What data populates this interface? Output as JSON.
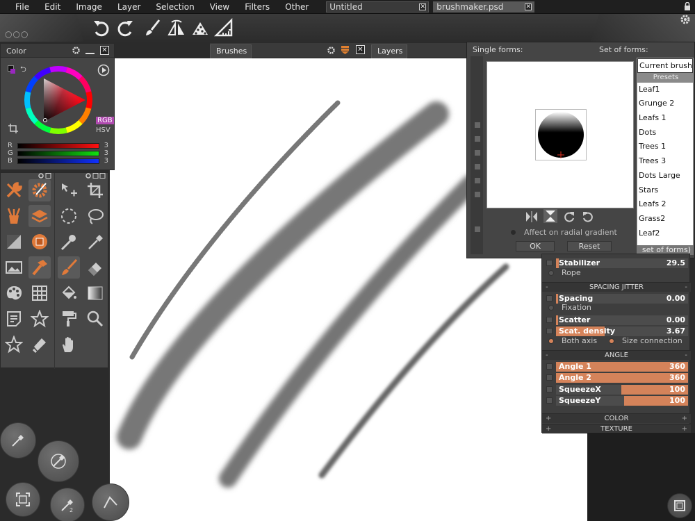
{
  "menubar": {
    "items": [
      "File",
      "Edit",
      "Image",
      "Layer",
      "Selection",
      "View",
      "Filters",
      "Other"
    ],
    "tabs": [
      {
        "label": "Untitled",
        "active": false
      },
      {
        "label": "brushmaker.psd",
        "active": true
      }
    ]
  },
  "toolbar": {
    "icons": [
      "undo-icon",
      "redo-icon",
      "brush-icon",
      "symmetry-icon",
      "brush-dots-icon",
      "ruler-icon"
    ]
  },
  "panels": {
    "tabs": [
      "Brushes",
      "Layers"
    ]
  },
  "color_panel": {
    "title": "Color",
    "mode_rgb": "RGB",
    "mode_hsv": "HSV",
    "channels": [
      {
        "label": "R",
        "value": "3",
        "color": "#ff2020"
      },
      {
        "label": "G",
        "value": "3",
        "color": "#20e020"
      },
      {
        "label": "B",
        "value": "3",
        "color": "#2030ff"
      }
    ]
  },
  "forms_panel": {
    "single_title": "Single forms:",
    "set_title": "Set of forms:",
    "set_items": [
      "Current brush",
      "Presets",
      "Leaf1",
      "Grunge 2",
      "Leafs 1",
      "Dots",
      "Trees 1",
      "Trees 3",
      "Dots Large",
      "Stars",
      "Leafs 2",
      "Grass2",
      "Leaf2"
    ],
    "set_footer": "set of forms)",
    "radial_label": "Affect on radial gradient",
    "ok_label": "OK",
    "reset_label": "Reset"
  },
  "settings": {
    "stabilizer": {
      "label": "Stabilizer",
      "value": "29.5"
    },
    "rope": "Rope",
    "spacing_header": "SPACING JITTER",
    "spacing": {
      "label": "Spacing",
      "value": "0.00"
    },
    "fixation": "Fixation",
    "scatter": {
      "label": "Scatter",
      "value": "0.00"
    },
    "scat_density": {
      "label": "Scat. density",
      "value": "3.67"
    },
    "both_axis": "Both axis",
    "size_connection": "Size connection",
    "angle_header": "ANGLE",
    "angle1": {
      "label": "Angle 1",
      "value": "360"
    },
    "angle2": {
      "label": "Angle 2",
      "value": "360"
    },
    "squeezex": {
      "label": "SqueezeX",
      "value": "100"
    },
    "squeezey": {
      "label": "SqueezeY",
      "value": "100"
    },
    "color_header": "COLOR",
    "texture_header": "TEXTURE"
  },
  "colors": {
    "accent": "#d5835a",
    "tool_orange": "#e07a3a",
    "panel_bg": "#454545"
  }
}
